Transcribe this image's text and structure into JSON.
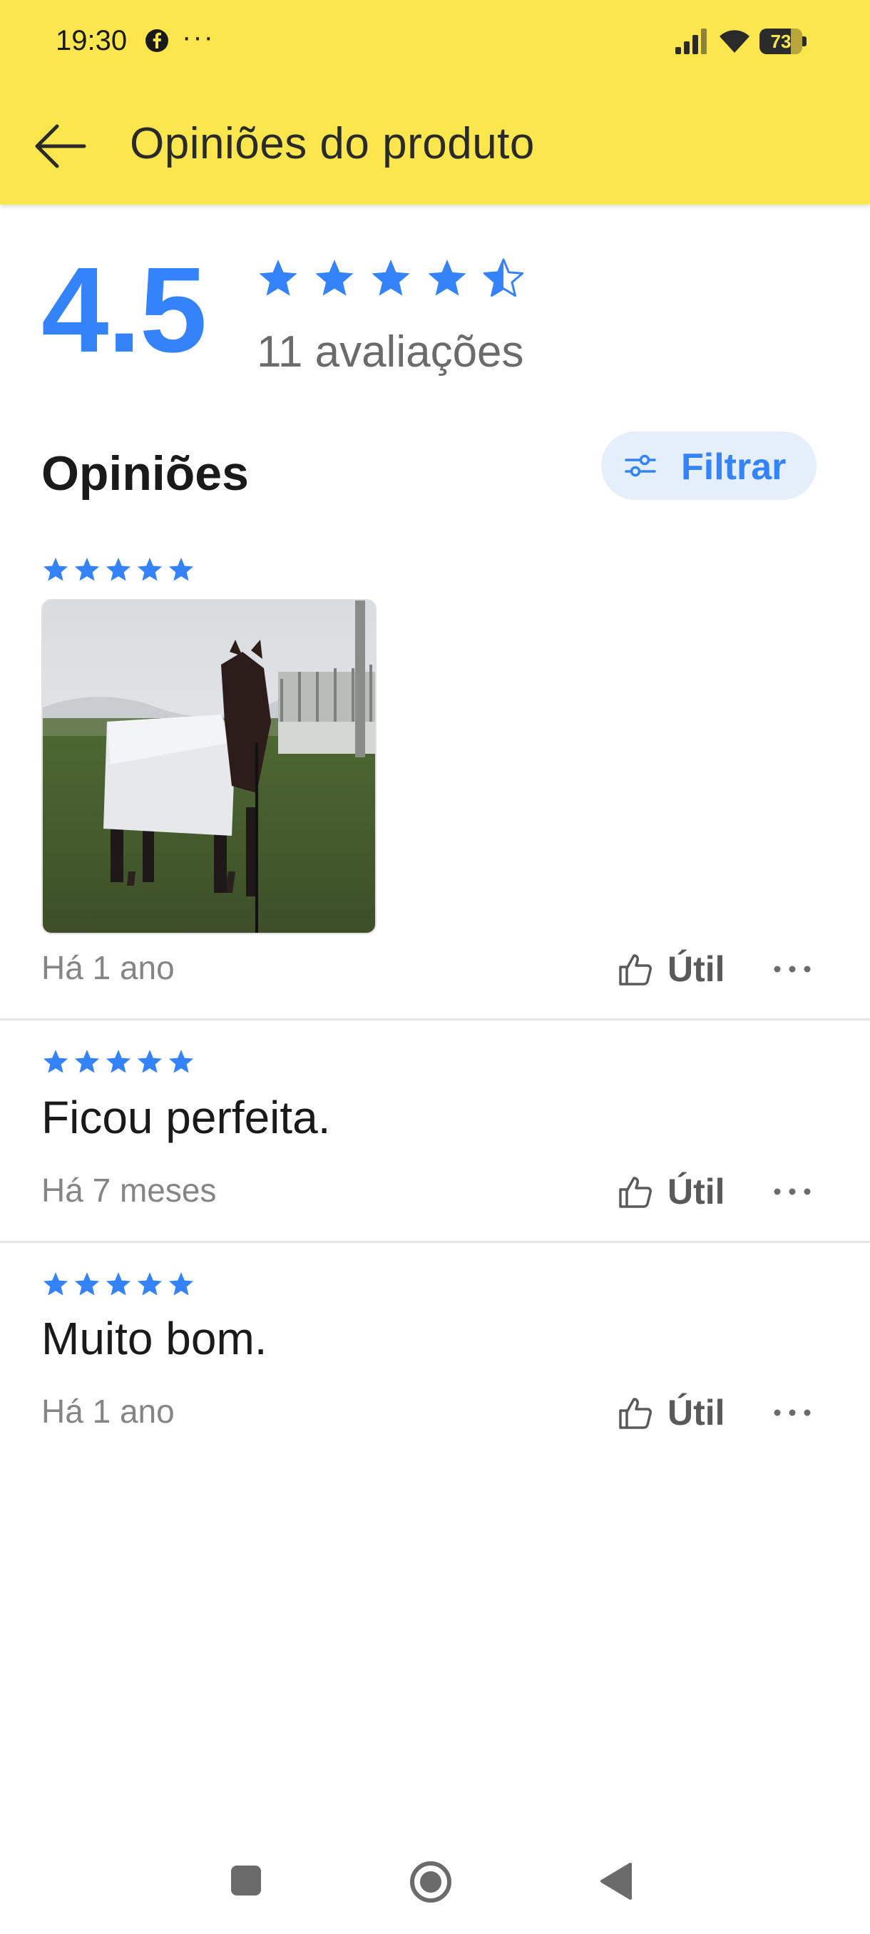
{
  "status_bar": {
    "time": "19:30",
    "status_dots": "···",
    "battery_level": "73",
    "icons": [
      "facebook-icon",
      "signal-icon",
      "wifi-icon",
      "battery-icon"
    ]
  },
  "app_bar": {
    "title": "Opiniões do produto",
    "back_icon": "arrow-left-icon"
  },
  "summary": {
    "average": "4.5",
    "rating_value": 4.5,
    "rating_max": 5,
    "count_label": "11 avaliações"
  },
  "section": {
    "title": "Opiniões",
    "filter_label": "Filtrar",
    "filter_icon": "sliders-icon"
  },
  "reviews": [
    {
      "rating": 5,
      "has_photo": true,
      "photo_subject": "horse-photo",
      "text": "",
      "date": "Há 1 ano",
      "useful_label": "Útil"
    },
    {
      "rating": 5,
      "has_photo": false,
      "text": "Ficou perfeita.",
      "date": "Há 7 meses",
      "useful_label": "Útil"
    },
    {
      "rating": 5,
      "has_photo": false,
      "text": "Muito bom.",
      "date": "Há 1 ano",
      "useful_label": "Útil"
    }
  ],
  "nav_bar": {
    "buttons": [
      "recent-apps-icon",
      "home-icon",
      "back-triangle-icon"
    ]
  },
  "colors": {
    "brand_yellow": "#fbe74d",
    "accent_blue": "#3483fa",
    "filter_bg": "#e5eefb",
    "muted_text": "#858585"
  }
}
